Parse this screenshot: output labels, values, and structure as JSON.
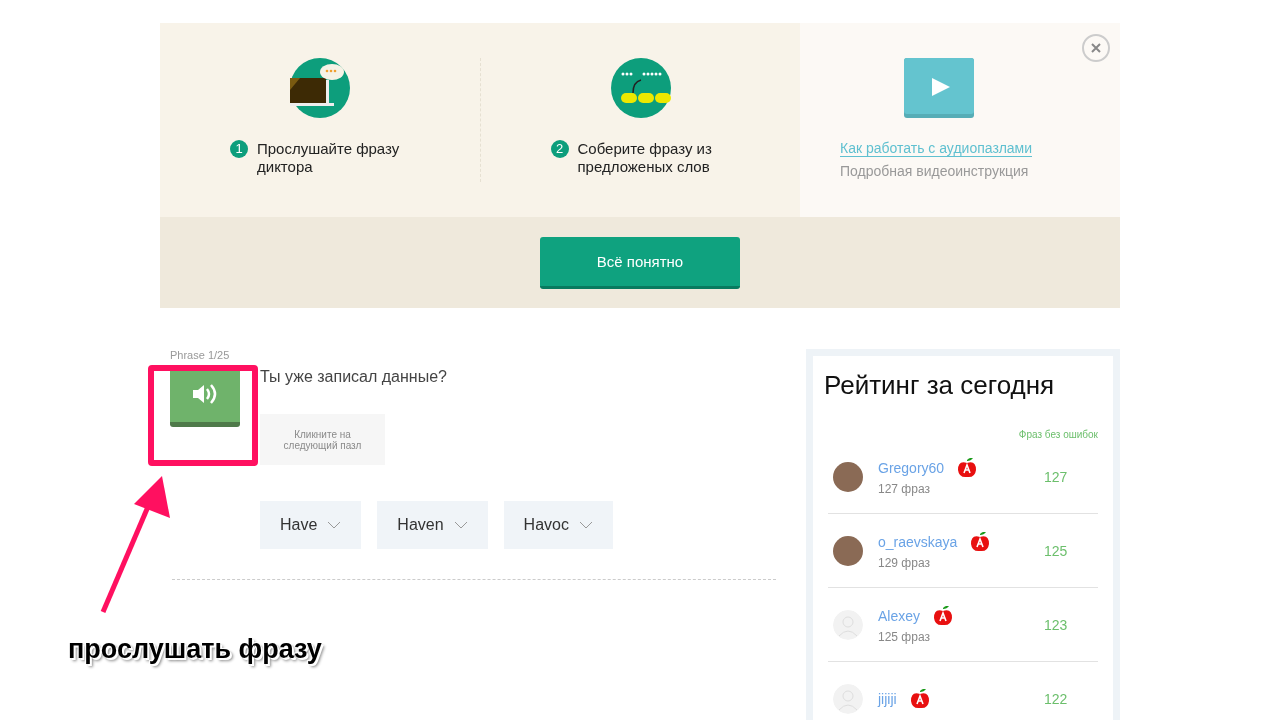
{
  "banner": {
    "steps": [
      {
        "number": "1",
        "text": "Прослушайте фразу диктора",
        "kind": "listen"
      },
      {
        "number": "2",
        "text": "Соберите фразу из предложеных слов",
        "kind": "assemble"
      }
    ],
    "video_link": "Как работать с аудиопазлами",
    "video_subtitle": "Подробная видеоинструкция",
    "confirm_button": "Всё понятно"
  },
  "exercise": {
    "phrase_counter": "Phrase 1/25",
    "question": "Ты уже записал данные?",
    "drop_hint": "Кликните на следующий пазл",
    "words": [
      {
        "label": "Have"
      },
      {
        "label": "Haven"
      },
      {
        "label": "Havoc"
      }
    ]
  },
  "rating": {
    "title": "Рейтинг за сегодня",
    "column_label": "Фраз без ошибок",
    "users": [
      {
        "name": "Gregory60",
        "phrases": "127 фраз",
        "score": "127",
        "kind": "photo"
      },
      {
        "name": "o_raevskaya",
        "phrases": "129 фраз",
        "score": "125",
        "kind": "photo"
      },
      {
        "name": "Alexey",
        "phrases": "125 фраз",
        "score": "123",
        "kind": "default"
      },
      {
        "name": "jijiji",
        "score": "122",
        "kind": "default"
      }
    ]
  },
  "annotation": {
    "caption": "прослушать фразу"
  }
}
